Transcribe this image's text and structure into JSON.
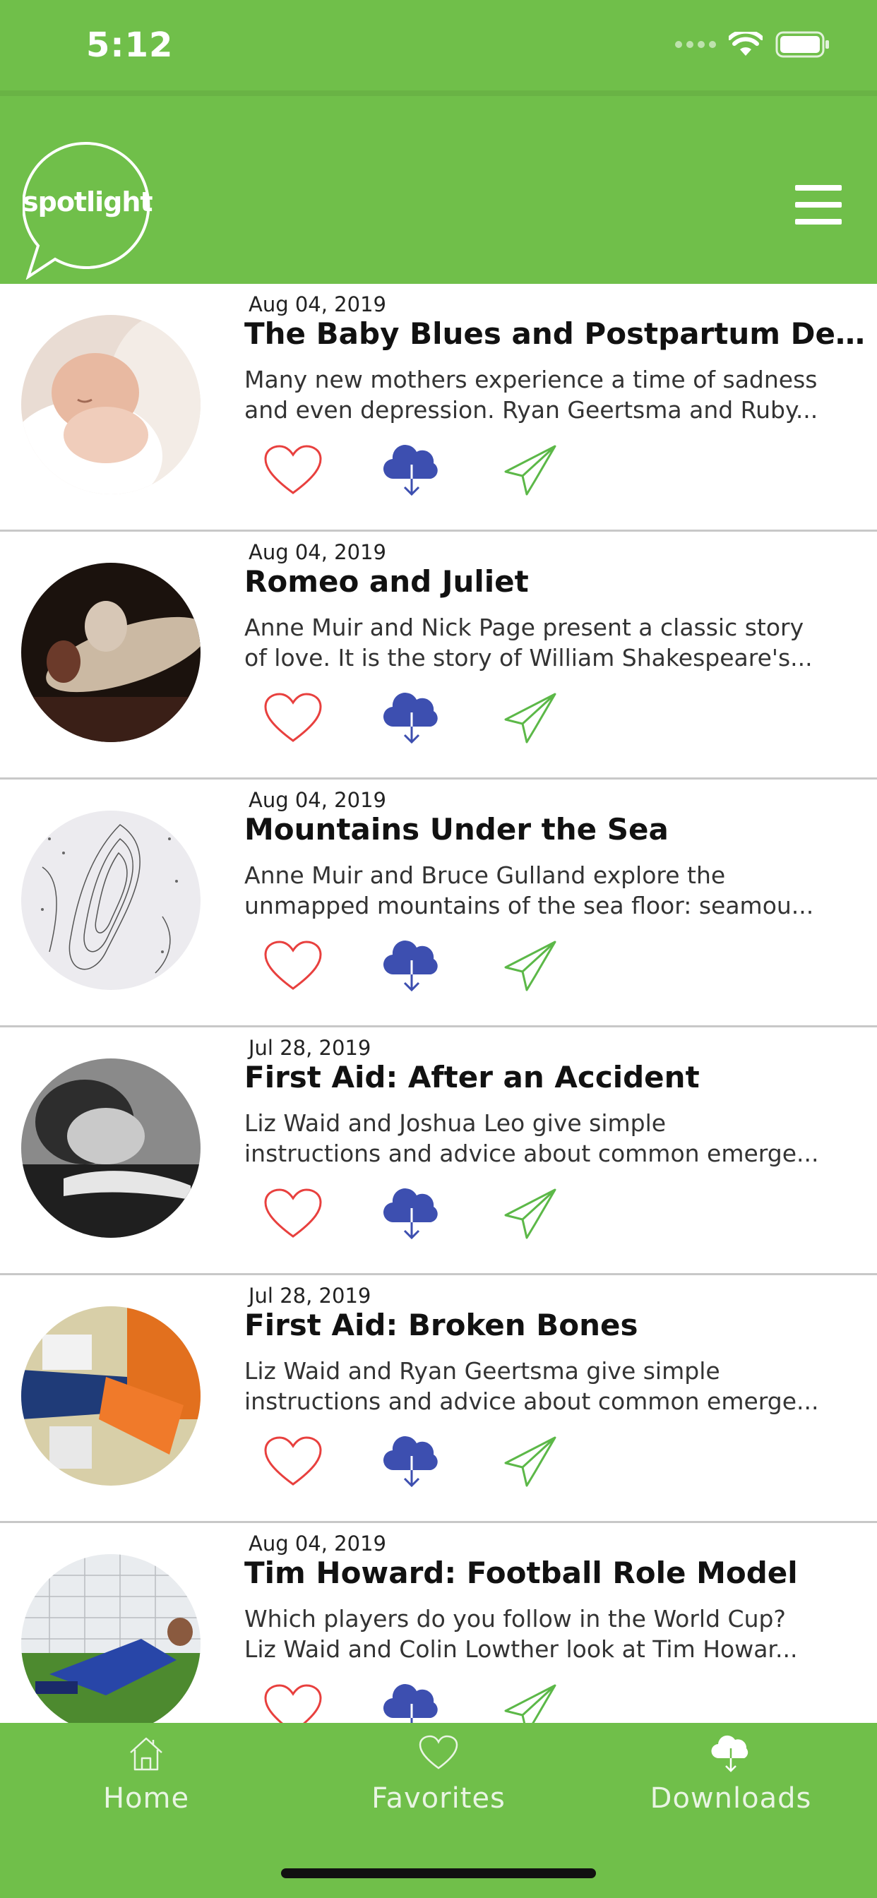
{
  "status_bar": {
    "time": "5:12"
  },
  "header": {
    "logo_text": "spotlight",
    "menu_icon": "hamburger-menu-icon"
  },
  "colors": {
    "brand_green": "#70bf4a",
    "heart_red": "#e8403e",
    "download_blue": "#3d4fb0",
    "share_green": "#5cb848"
  },
  "items": [
    {
      "date": "Aug 04, 2019",
      "title": "The Baby Blues and Postpartum Dep...",
      "desc_line1": "Many new mothers experience a time of sadness",
      "desc_line2": "and even depression. Ryan Geertsma and Ruby...",
      "image": "newborn-baby-photo"
    },
    {
      "date": "Aug 04, 2019",
      "title": "Romeo and Juliet",
      "desc_line1": "Anne Muir and Nick Page present a classic story",
      "desc_line2": "of love. It is the story of William Shakespeare's...",
      "image": "theatre-stage-photo"
    },
    {
      "date": "Aug 04, 2019",
      "title": "Mountains Under the Sea",
      "desc_line1": "Anne Muir and Bruce Gulland explore the",
      "desc_line2": "unmapped mountains of the sea floor: seamou...",
      "image": "seafloor-map-image"
    },
    {
      "date": "Jul 28, 2019",
      "title": "First Aid: After an Accident",
      "desc_line1": "Liz Waid and Joshua Leo give simple",
      "desc_line2": "instructions and advice about common emerge...",
      "image": "person-lying-down-photo"
    },
    {
      "date": "Jul 28, 2019",
      "title": "First Aid: Broken Bones",
      "desc_line1": "Liz Waid and Ryan Geertsma give simple",
      "desc_line2": "instructions and advice about common emerge...",
      "image": "leg-cast-photo"
    },
    {
      "date": "Aug 04, 2019",
      "title": "Tim Howard: Football Role Model",
      "desc_line1": "Which players do you follow in the World Cup?",
      "desc_line2": "Liz Waid and Colin Lowther look at Tim Howar...",
      "image": "goalkeeper-photo"
    }
  ],
  "tab_bar": {
    "home": "Home",
    "favorites": "Favorites",
    "downloads": "Downloads"
  }
}
